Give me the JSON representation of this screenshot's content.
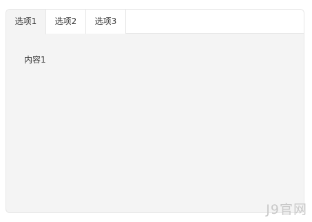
{
  "tabs": [
    {
      "label": "选项1",
      "active": true
    },
    {
      "label": "选项2",
      "active": false
    },
    {
      "label": "选项3",
      "active": false
    }
  ],
  "content": {
    "text": "内容1"
  },
  "watermark": {
    "text": "J9官网"
  },
  "colors": {
    "panel_background": "#f4f4f4",
    "tab_background": "#ffffff",
    "border": "#e6e6e6",
    "text": "#333333",
    "watermark": "#c9c9c9"
  }
}
